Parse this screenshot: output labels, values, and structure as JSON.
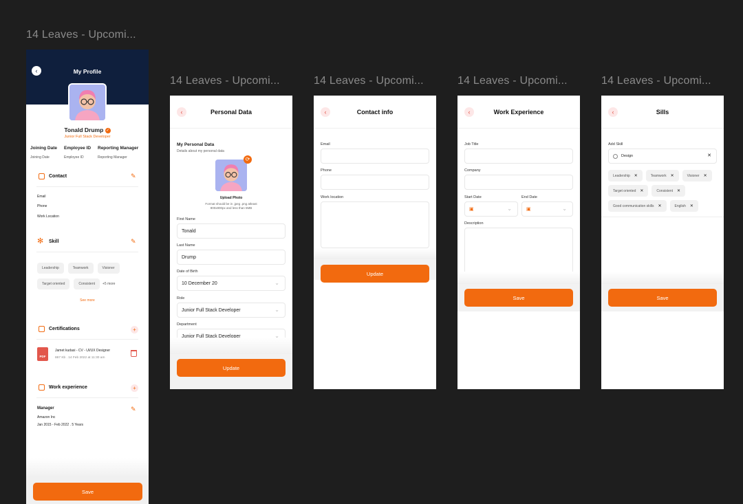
{
  "frame_titles": [
    "14 Leaves - Upcomi...",
    "14 Leaves - Upcomi...",
    "14 Leaves - Upcomi...",
    "14 Leaves - Upcomi...",
    "14 Leaves - Upcomi..."
  ],
  "profile": {
    "title": "My Profile",
    "name": "Tonald Drump",
    "role": "Junior Full Stack Developer",
    "meta": [
      {
        "header": "Joining Date",
        "value": "Joining Date"
      },
      {
        "header": "Employee ID",
        "value": "Employee ID"
      },
      {
        "header": "Reporting Manager",
        "value": "Reporting Manager"
      }
    ],
    "contact": {
      "title": "Contact",
      "fields": [
        "Email",
        "Phone",
        "Work Location"
      ]
    },
    "skill": {
      "title": "Skill",
      "chips": [
        "Leadership",
        "Teamwork",
        "Visioner",
        "Target oriented",
        "Consistent"
      ],
      "more": "+5 more",
      "see_more": "See more"
    },
    "certifications": {
      "title": "Certifications",
      "file_name": "Jamet kudasi - CV - UI/UX Designer",
      "file_meta": "867 Kb . 14 Feb 2022 at 11:30 am",
      "file_badge": "PDF"
    },
    "work": {
      "title": "Work experience",
      "position": "Manager",
      "company": "Amazon Inc",
      "period": "Jan 2015 - Feb 2022 . 5 Years"
    },
    "save": "Save"
  },
  "personal": {
    "title": "Personal Data",
    "section_title": "My Personal Data",
    "section_sub": "Details about my personal data",
    "upload_label": "Upload Photo",
    "upload_hint_1": "Format should be in .jpeg .png atleast",
    "upload_hint_2": "800x800px and less than 5MB",
    "fields": [
      {
        "label": "First Name",
        "value": "Tonald"
      },
      {
        "label": "Last Name",
        "value": "Drump"
      },
      {
        "label": "Date of Birth",
        "value": "10 December 20"
      },
      {
        "label": "Role",
        "value": "Junior Full Stack Developer"
      },
      {
        "label": "Department",
        "value": "Junior Full Stack Developer"
      }
    ],
    "button": "Update"
  },
  "contact_info": {
    "title": "Contact info",
    "email_label": "Email",
    "phone_label": "Phone",
    "location_label": "Work location",
    "button": "Update"
  },
  "work_exp": {
    "title": "Work Experience",
    "job_label": "Job Title",
    "company_label": "Company",
    "start_label": "Start Date",
    "end_label": "End Date",
    "desc_label": "Description",
    "button": "Save"
  },
  "skills": {
    "title": "Sills",
    "add_label": "Add Skill",
    "search_value": "Design",
    "chips": [
      "Leadership",
      "Teamwork",
      "Visioner",
      "Target oriented",
      "Consistent",
      "Good communication skills",
      "English"
    ],
    "button": "Save"
  },
  "colors": {
    "accent": "#f26a0f",
    "navy": "#0f1f3d",
    "background": "#1e1e1e"
  }
}
